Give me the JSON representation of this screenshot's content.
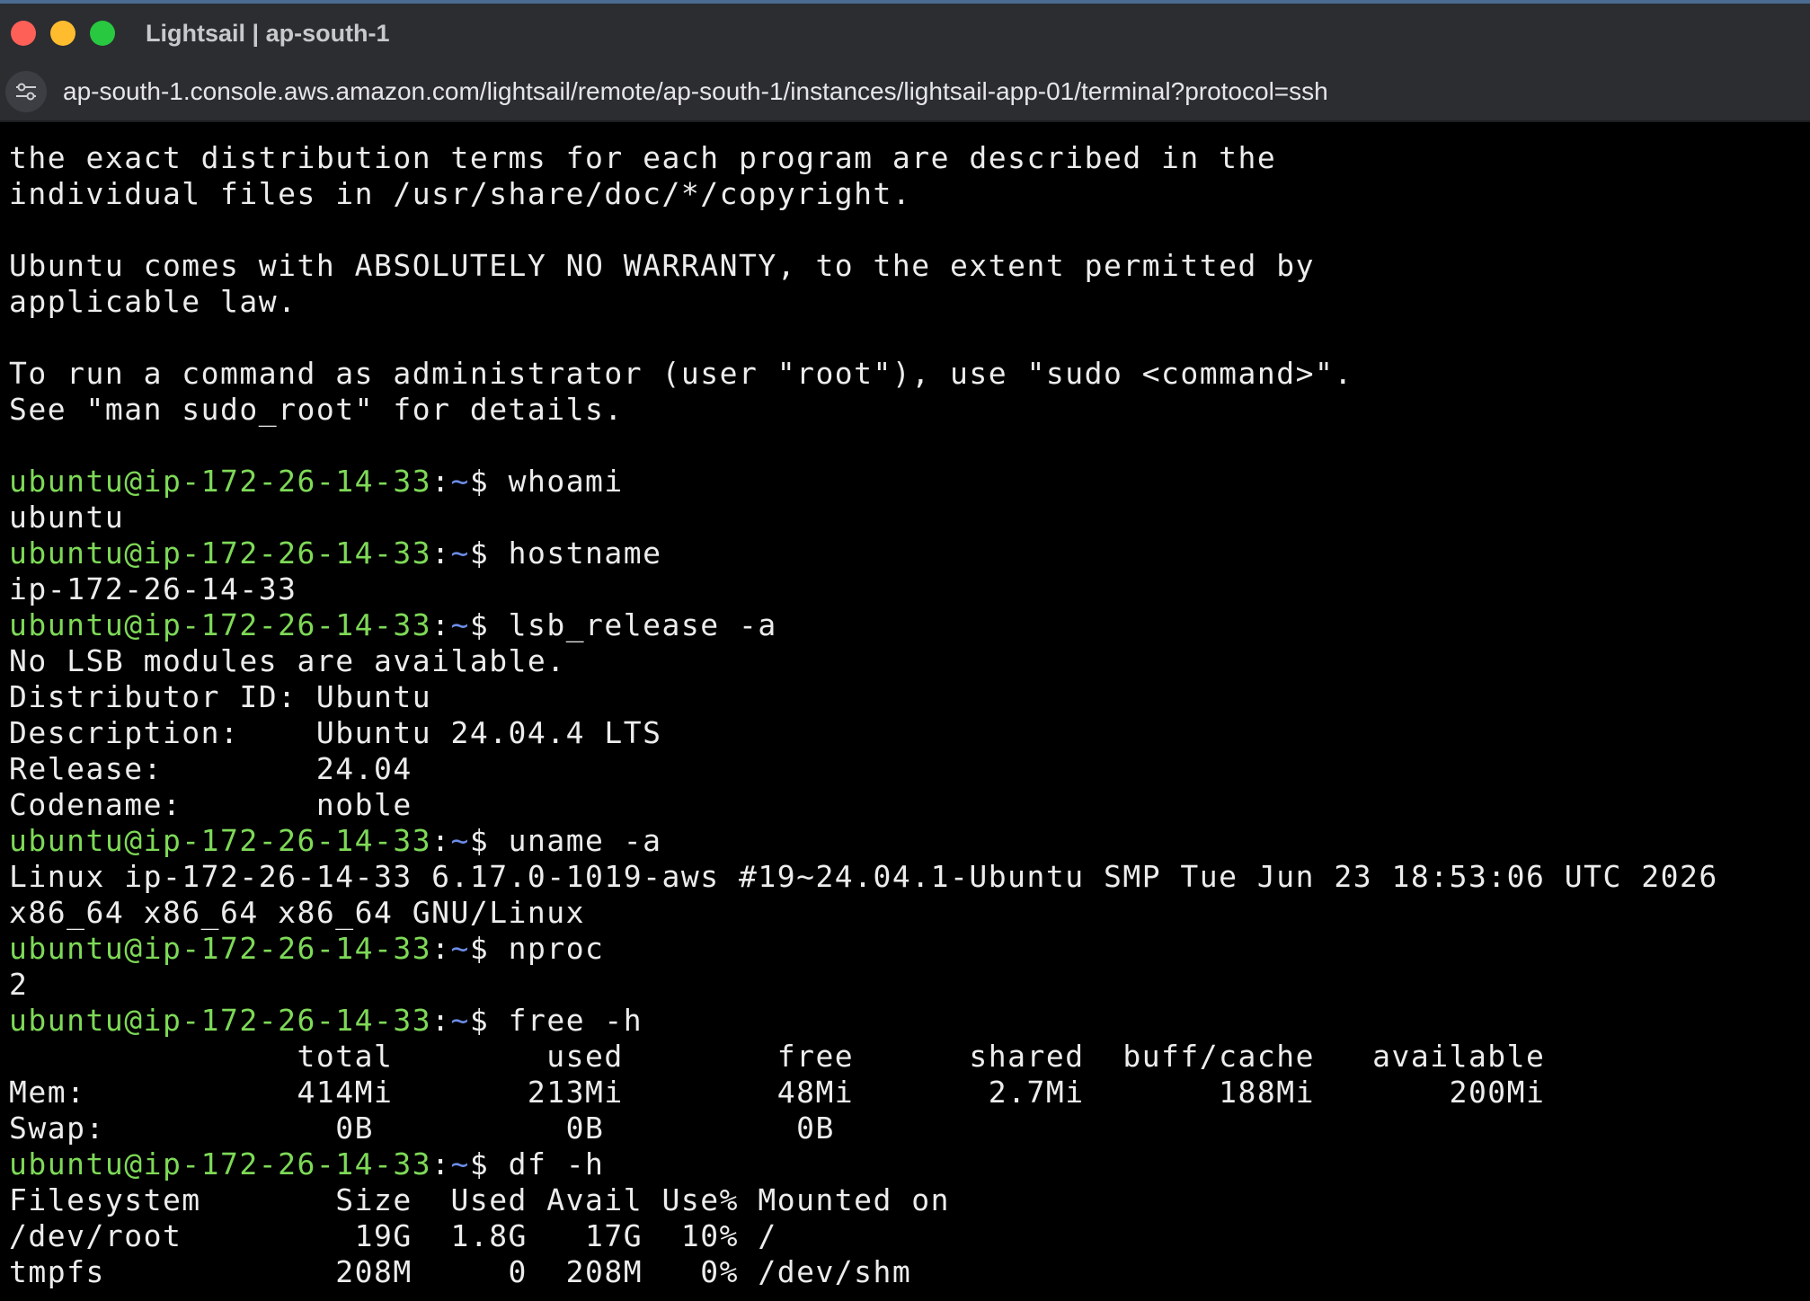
{
  "window": {
    "title": "Lightsail | ap-south-1"
  },
  "address_bar": {
    "url": "ap-south-1.console.aws.amazon.com/lightsail/remote/ap-south-1/instances/lightsail-app-01/terminal?protocol=ssh",
    "site_icon": "tune-icon"
  },
  "colors": {
    "prompt_user": "#7ed957",
    "prompt_path": "#6c8de8",
    "text": "#ececec",
    "background": "#000000"
  },
  "terminal": {
    "prompt": {
      "user_host": "ubuntu@ip-172-26-14-33",
      "separator": ":",
      "path": "~",
      "symbol": "$"
    },
    "lines": [
      {
        "type": "out",
        "text": "the exact distribution terms for each program are described in the"
      },
      {
        "type": "out",
        "text": "individual files in /usr/share/doc/*/copyright."
      },
      {
        "type": "out",
        "text": ""
      },
      {
        "type": "out",
        "text": "Ubuntu comes with ABSOLUTELY NO WARRANTY, to the extent permitted by"
      },
      {
        "type": "out",
        "text": "applicable law."
      },
      {
        "type": "out",
        "text": ""
      },
      {
        "type": "out",
        "text": "To run a command as administrator (user \"root\"), use \"sudo <command>\"."
      },
      {
        "type": "out",
        "text": "See \"man sudo_root\" for details."
      },
      {
        "type": "out",
        "text": ""
      },
      {
        "type": "cmd",
        "text": " whoami"
      },
      {
        "type": "out",
        "text": "ubuntu"
      },
      {
        "type": "cmd",
        "text": " hostname"
      },
      {
        "type": "out",
        "text": "ip-172-26-14-33"
      },
      {
        "type": "cmd",
        "text": " lsb_release -a"
      },
      {
        "type": "out",
        "text": "No LSB modules are available."
      },
      {
        "type": "out",
        "text": "Distributor ID: Ubuntu"
      },
      {
        "type": "out",
        "text": "Description:    Ubuntu 24.04.4 LTS"
      },
      {
        "type": "out",
        "text": "Release:        24.04"
      },
      {
        "type": "out",
        "text": "Codename:       noble"
      },
      {
        "type": "cmd",
        "text": " uname -a"
      },
      {
        "type": "out",
        "text": "Linux ip-172-26-14-33 6.17.0-1019-aws #19~24.04.1-Ubuntu SMP Tue Jun 23 18:53:06 UTC 2026"
      },
      {
        "type": "out",
        "text": "x86_64 x86_64 x86_64 GNU/Linux"
      },
      {
        "type": "cmd",
        "text": " nproc"
      },
      {
        "type": "out",
        "text": "2"
      },
      {
        "type": "cmd",
        "text": " free -h"
      },
      {
        "type": "out",
        "text": "               total        used        free      shared  buff/cache   available"
      },
      {
        "type": "out",
        "text": "Mem:           414Mi       213Mi        48Mi       2.7Mi       188Mi       200Mi"
      },
      {
        "type": "out",
        "text": "Swap:            0B          0B          0B"
      },
      {
        "type": "cmd",
        "text": " df -h"
      },
      {
        "type": "out",
        "text": "Filesystem       Size  Used Avail Use% Mounted on"
      },
      {
        "type": "out",
        "text": "/dev/root         19G  1.8G   17G  10% /"
      },
      {
        "type": "out",
        "text": "tmpfs            208M     0  208M   0% /dev/shm"
      }
    ]
  }
}
